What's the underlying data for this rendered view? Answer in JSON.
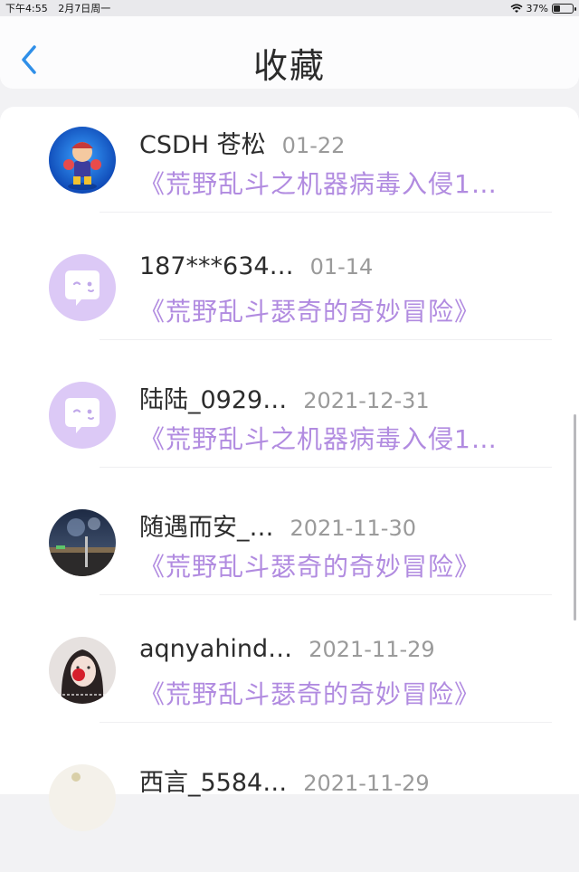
{
  "status_bar": {
    "time": "下午4:55",
    "date": "2月7日周一",
    "battery": "37%",
    "battery_level": 0.37
  },
  "header": {
    "title": "收藏",
    "back_icon": "chevron-left-icon"
  },
  "colors": {
    "accent_blue": "#2f8fe8",
    "book_purple": "#b18be0",
    "placeholder_avatar": "#dcc9f6"
  },
  "favorites": [
    {
      "user": "CSDH 苍松",
      "date": "01-22",
      "book": "《荒野乱斗之机器病毒入侵1…",
      "avatar": "game-character-avatar"
    },
    {
      "user": "187***634…",
      "date": "01-14",
      "book": "《荒野乱斗瑟奇的奇妙冒险》",
      "avatar": "default-chat-avatar"
    },
    {
      "user": "陆陆_0929…",
      "date": "2021-12-31",
      "book": "《荒野乱斗之机器病毒入侵1…",
      "avatar": "default-chat-avatar"
    },
    {
      "user": "随遇而安_…",
      "date": "2021-11-30",
      "book": "《荒野乱斗瑟奇的奇妙冒险》",
      "avatar": "city-night-photo-avatar"
    },
    {
      "user": "aqnyahind…",
      "date": "2021-11-29",
      "book": "《荒野乱斗瑟奇的奇妙冒险》",
      "avatar": "girl-portrait-avatar"
    },
    {
      "user": "西言_5584…",
      "date": "2021-11-29",
      "book": "",
      "avatar": "partial-avatar"
    }
  ]
}
